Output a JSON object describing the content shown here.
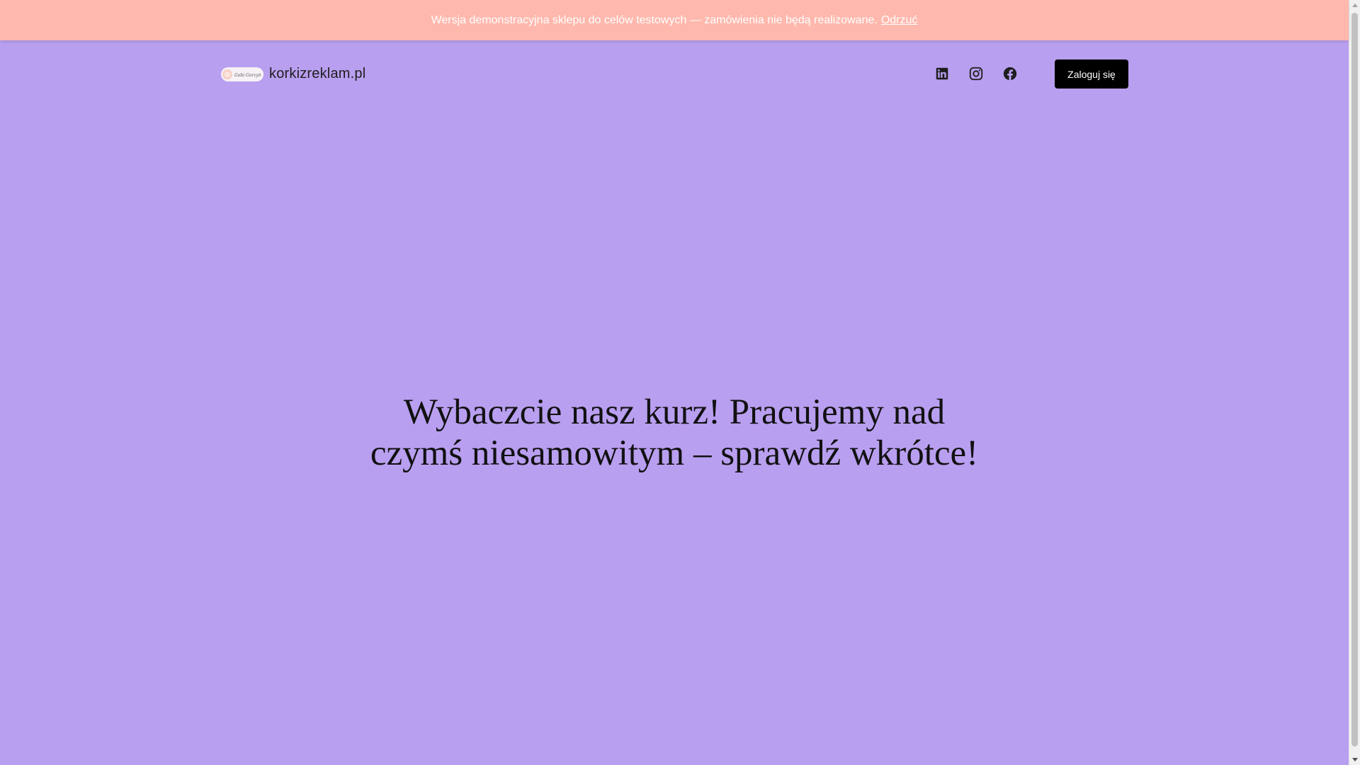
{
  "store_notice": {
    "text": "Wersja demonstracyjna sklepu do celów testowych — zamówienia nie będą realizowane.",
    "dismiss_label": "Odrzuć"
  },
  "header": {
    "site_title": "korkizreklam.pl",
    "logo_text": "Gabi Gorzyń",
    "socials": [
      {
        "name": "LinkedIn",
        "icon": "linkedin-icon"
      },
      {
        "name": "Instagram",
        "icon": "instagram-icon"
      },
      {
        "name": "Facebook",
        "icon": "facebook-icon"
      }
    ],
    "login_label": "Zaloguj się"
  },
  "hero": {
    "line1": "Wybaczcie nasz kurz! Pracujemy nad",
    "line2": "czymś niesamowitym – sprawdź wkrótce!"
  },
  "colors": {
    "background": "#b99ff0",
    "notice_background": "#ffb8ad",
    "button_background": "#000000",
    "button_text": "#ffffff",
    "text": "#1e1e1e"
  }
}
